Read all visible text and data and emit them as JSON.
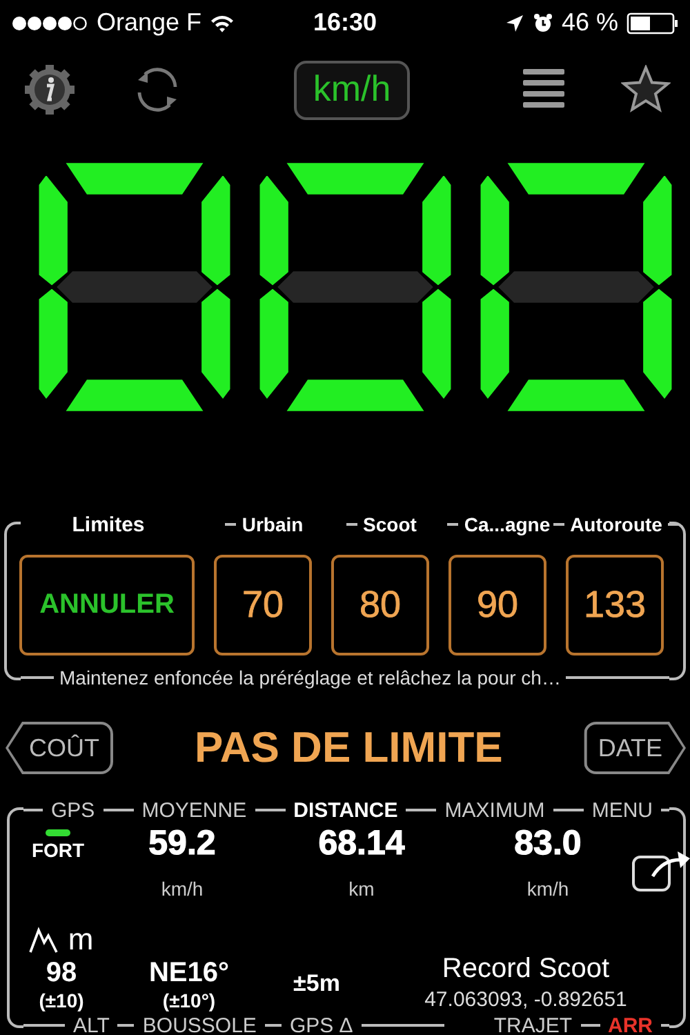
{
  "status_bar": {
    "carrier": "Orange F",
    "time": "16:30",
    "battery": "46 %"
  },
  "toolbar": {
    "unit": "km/h"
  },
  "speed": {
    "digits": [
      {
        "segments": [
          true,
          true,
          true,
          true,
          true,
          true,
          false
        ]
      },
      {
        "segments": [
          true,
          true,
          true,
          true,
          true,
          true,
          false
        ]
      },
      {
        "segments": [
          true,
          true,
          true,
          true,
          true,
          true,
          false
        ]
      }
    ]
  },
  "limits": {
    "title": "Limites",
    "cancel": "ANNULER",
    "presets": [
      {
        "label": "Urbain",
        "value": "70"
      },
      {
        "label": "Scoot",
        "value": "80"
      },
      {
        "label": "Ca...agne",
        "value": "90"
      },
      {
        "label": "Autoroute",
        "value": "133"
      }
    ],
    "hint": "Maintenez enfoncée la préréglage et relâchez la pour ch…"
  },
  "limit_bar": {
    "left_button": "COÛT",
    "status": "PAS DE LIMITE",
    "right_button": "DATE"
  },
  "stats": {
    "header": [
      {
        "label": "GPS",
        "bold": false
      },
      {
        "label": "MOYENNE",
        "bold": false
      },
      {
        "label": "DISTANCE",
        "bold": true
      },
      {
        "label": "MAXIMUM",
        "bold": false
      },
      {
        "label": "MENU",
        "bold": false
      }
    ],
    "gps_strength": "FORT",
    "metrics": [
      {
        "value": "59.2",
        "unit": "km/h"
      },
      {
        "value": "68.14",
        "unit": "km"
      },
      {
        "value": "83.0",
        "unit": "km/h"
      }
    ],
    "altitude": {
      "unit": "m",
      "value": "98",
      "accuracy": "(±10)"
    },
    "compass": {
      "value": "NE16°",
      "accuracy": "(±10°)"
    },
    "gps_accuracy": "±5m",
    "trip": {
      "name": "Record Scoot",
      "coordinates": "47.063093, -0.892651"
    },
    "footer": [
      {
        "label": "ALT",
        "alert": false
      },
      {
        "label": "BOUSSOLE",
        "alert": false
      },
      {
        "label": "GPS Δ",
        "alert": false
      },
      {
        "label": "TRAJET",
        "alert": false
      },
      {
        "label": "ARR",
        "alert": true
      }
    ]
  }
}
